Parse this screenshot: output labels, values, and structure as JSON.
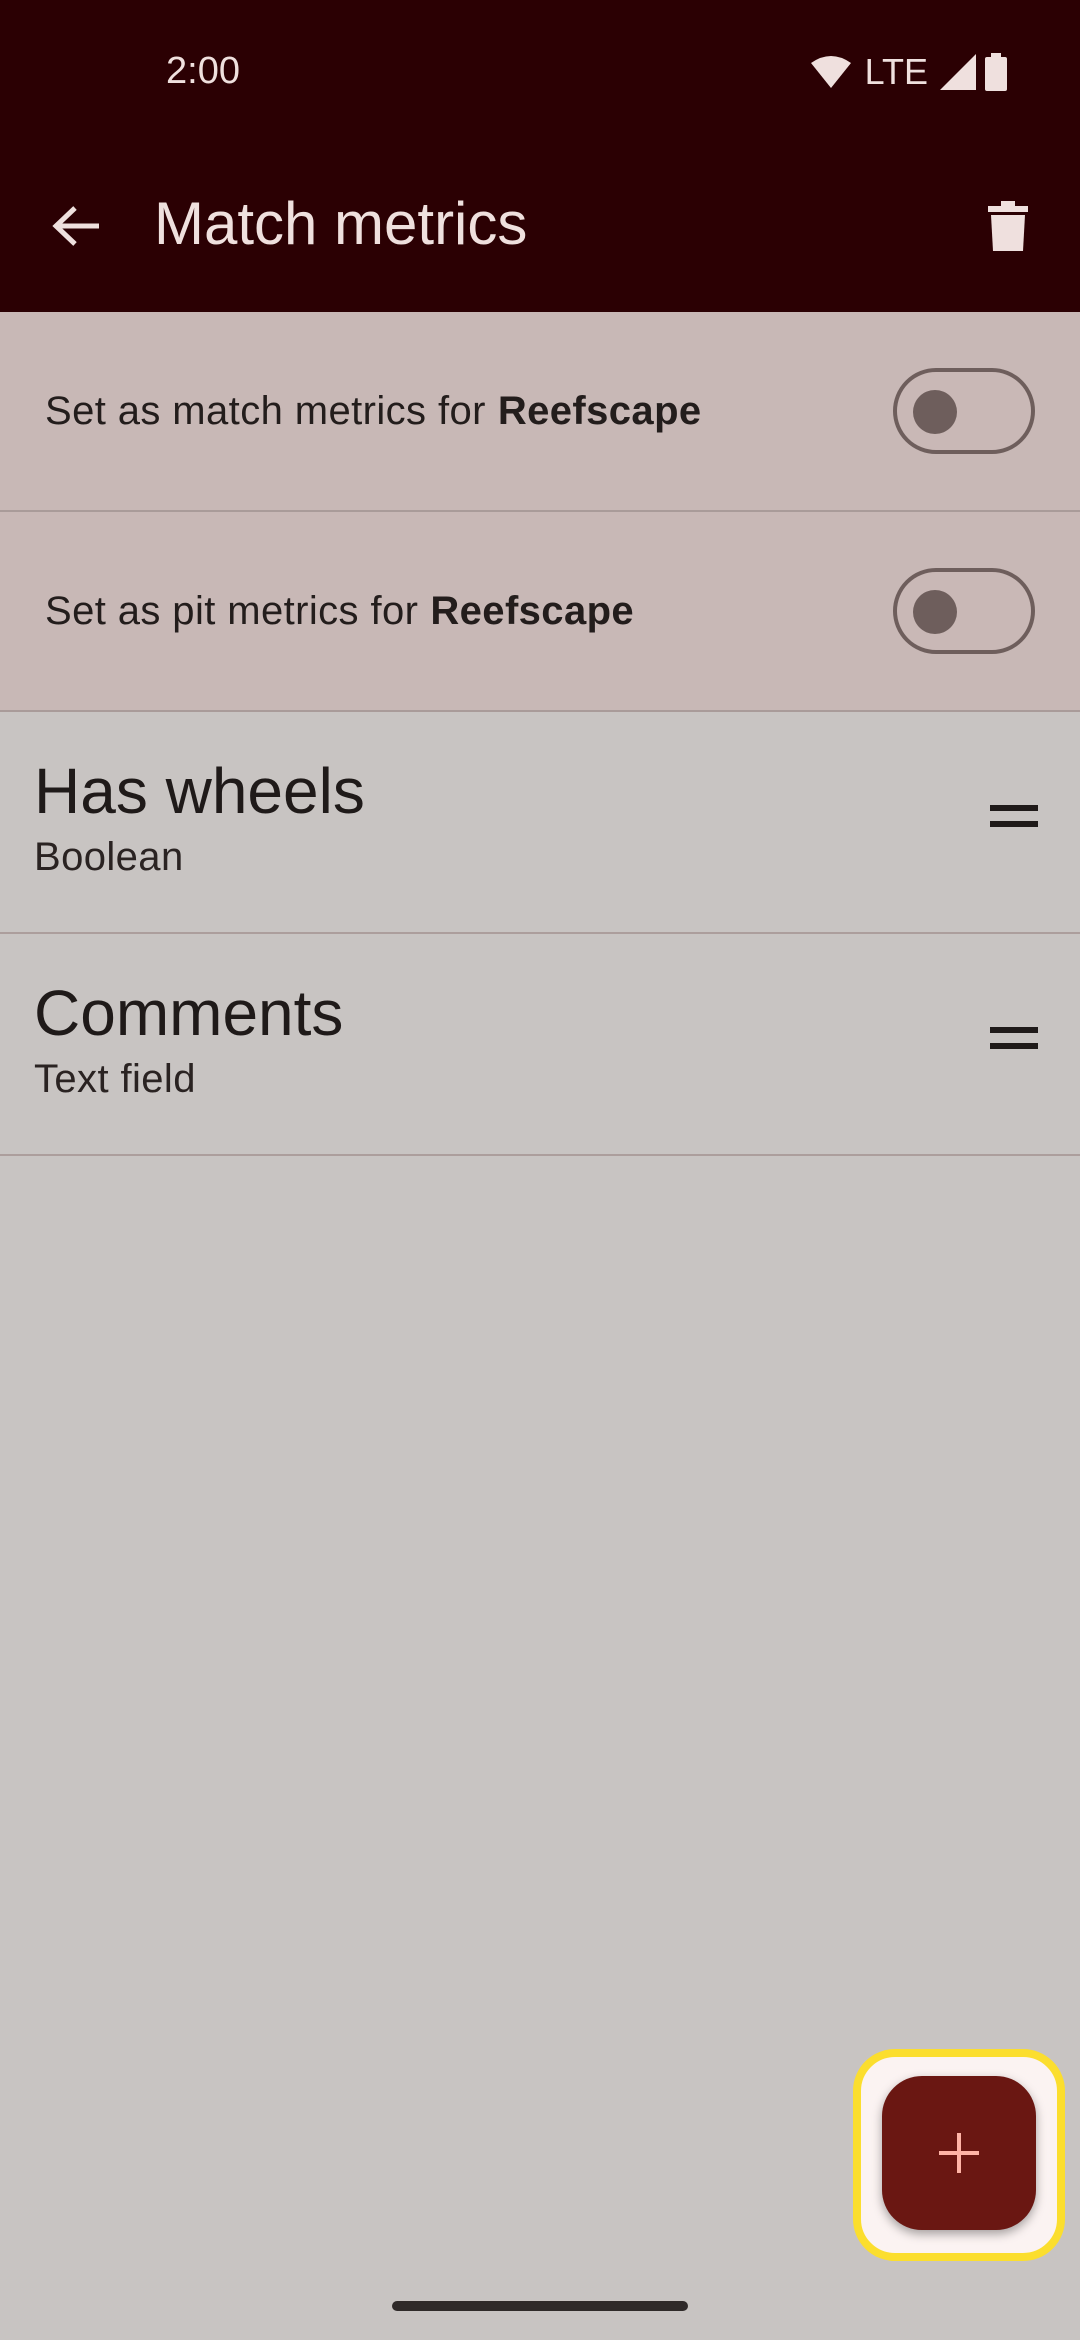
{
  "status_bar": {
    "time": "2:00",
    "network": "LTE"
  },
  "app_bar": {
    "title": "Match metrics",
    "back_icon": "arrow-back-icon",
    "delete_icon": "trash-icon"
  },
  "settings": [
    {
      "prefix": "Set as match metrics for",
      "game": "Reefscape",
      "enabled": false
    },
    {
      "prefix": "Set as pit metrics for",
      "game": "Reefscape",
      "enabled": false
    }
  ],
  "metrics": [
    {
      "name": "Has wheels",
      "type": "Boolean"
    },
    {
      "name": "Comments",
      "type": "Text field"
    }
  ],
  "fab": {
    "icon": "plus-icon",
    "symbol": "+"
  },
  "colors": {
    "primary_dark": "#2b0003",
    "fab": "#6a1712",
    "fab_icon": "#ffb4a6",
    "highlight": "#fbde2e",
    "background": "#c8c4c2",
    "settings_background": "#c8b8b6"
  }
}
